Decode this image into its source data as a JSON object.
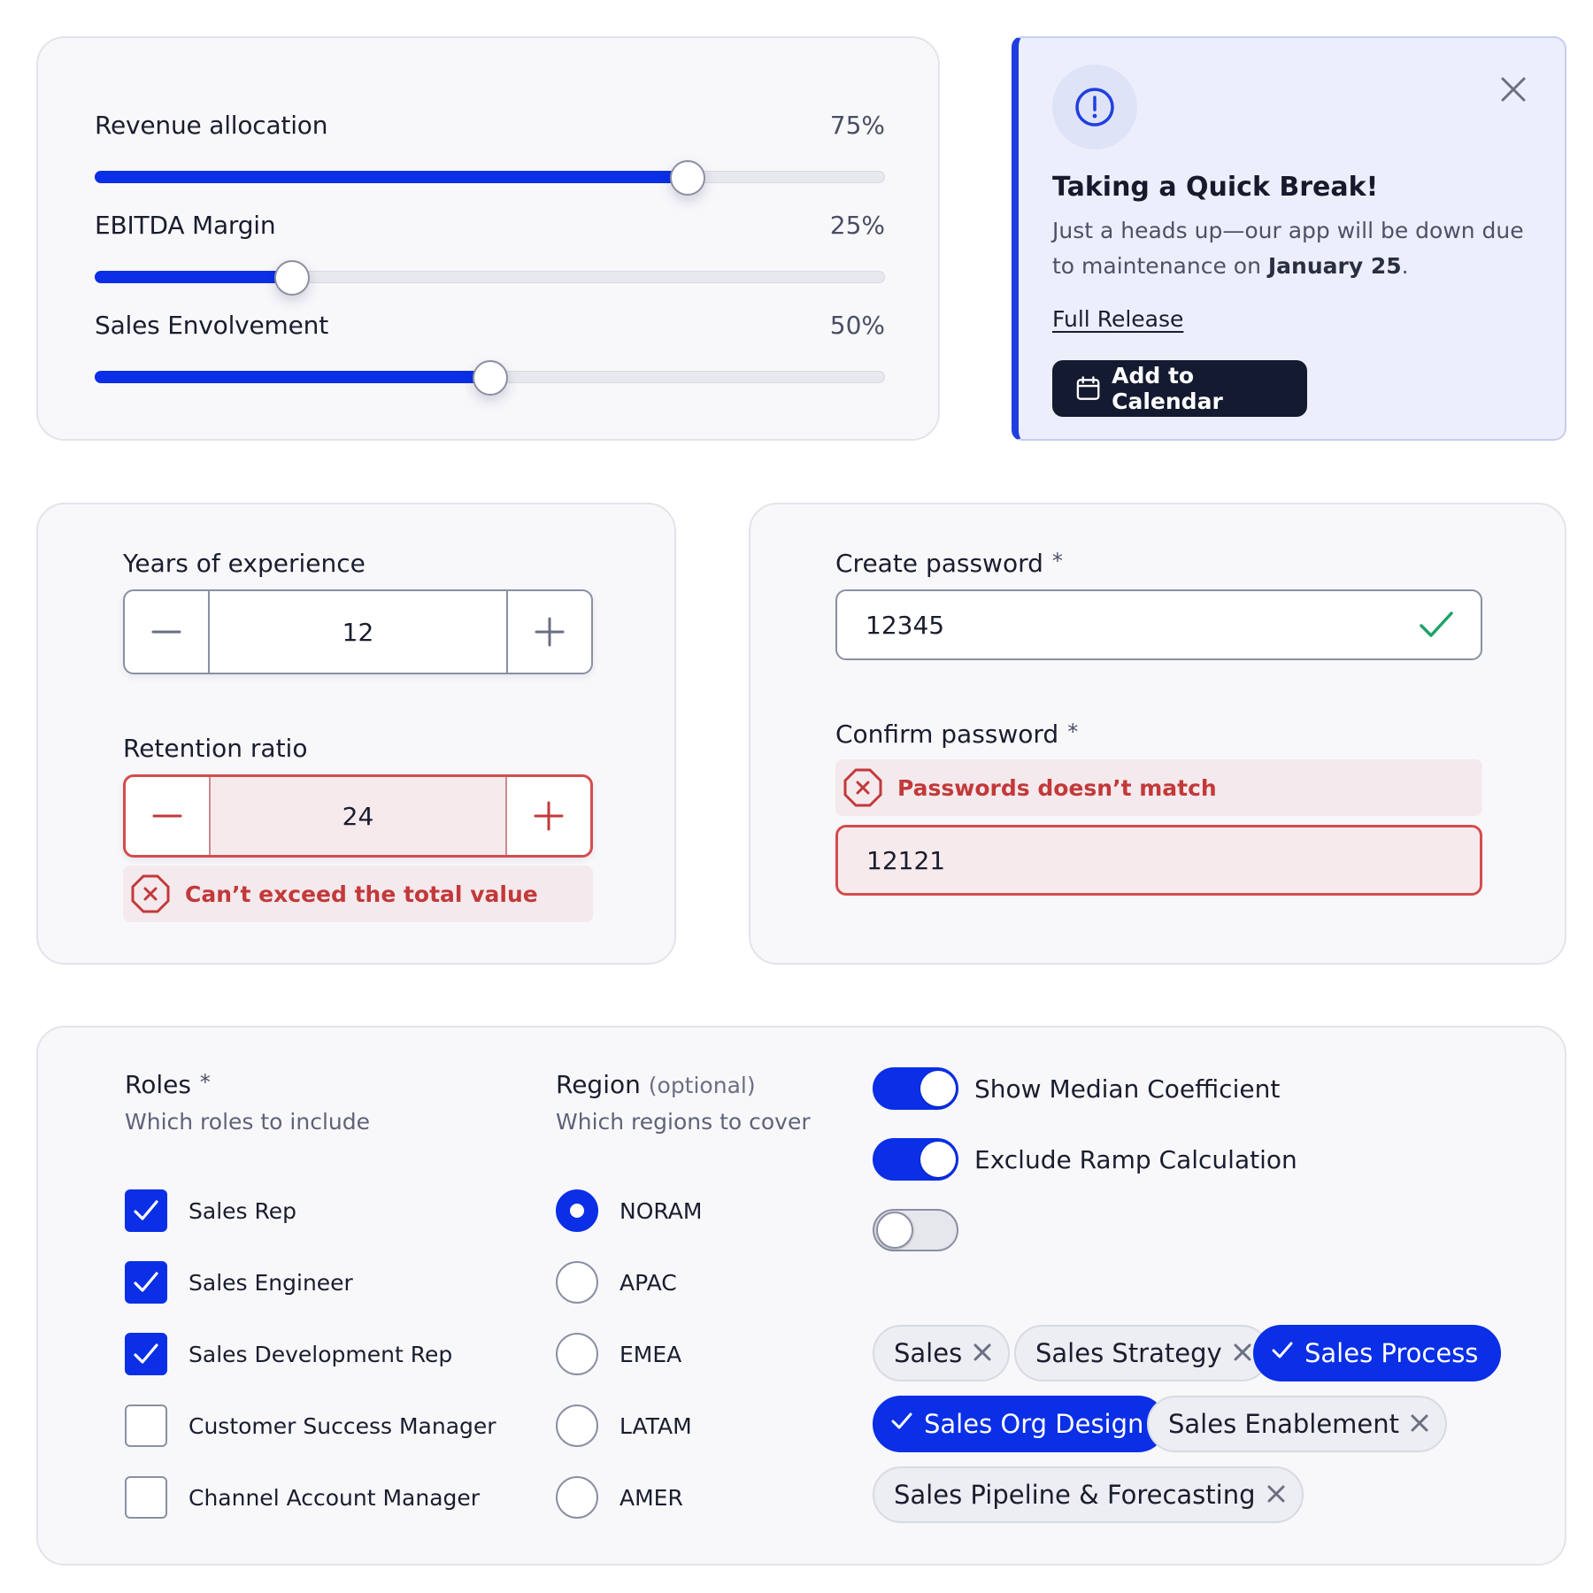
{
  "sliders": [
    {
      "label": "Revenue allocation",
      "value_text": "75%",
      "value": 0.75
    },
    {
      "label": "EBITDA Margin",
      "value_text": "25%",
      "value": 0.25
    },
    {
      "label": "Sales Envolvement",
      "value_text": "50%",
      "value": 0.5
    }
  ],
  "notice": {
    "title": "Taking a Quick Break!",
    "body_prefix": "Just a heads up—our app will be down due to maintenance on ",
    "body_date": "January 25",
    "body_suffix": ".",
    "link": "Full Release",
    "button": "Add to Calendar"
  },
  "steppers": {
    "experience": {
      "label": "Years of experience",
      "value": "12"
    },
    "retention": {
      "label": "Retention ratio",
      "value": "24",
      "error": "Can’t exceed the total value"
    }
  },
  "passwords": {
    "create": {
      "label": "Create password",
      "required": "*",
      "value": "12345"
    },
    "confirm": {
      "label": "Confirm password",
      "required": "*",
      "value": "12121",
      "error": "Passwords doesn’t match"
    }
  },
  "roles": {
    "title": "Roles",
    "required": "*",
    "subtitle": "Which roles to include",
    "items": [
      {
        "label": "Sales Rep",
        "checked": true
      },
      {
        "label": "Sales Engineer",
        "checked": true
      },
      {
        "label": "Sales Development Rep",
        "checked": true
      },
      {
        "label": "Customer Success Manager",
        "checked": false
      },
      {
        "label": "Channel Account Manager",
        "checked": false
      }
    ]
  },
  "region": {
    "title": "Region",
    "optional": "(optional)",
    "subtitle": "Which regions to cover",
    "items": [
      {
        "label": "NORAM",
        "selected": true
      },
      {
        "label": "APAC",
        "selected": false
      },
      {
        "label": "EMEA",
        "selected": false
      },
      {
        "label": "LATAM",
        "selected": false
      },
      {
        "label": "AMER",
        "selected": false
      }
    ]
  },
  "toggles": [
    {
      "label": "Show Median Coefficient",
      "on": true
    },
    {
      "label": "Exclude Ramp Calculation",
      "on": true
    },
    {
      "label": "",
      "on": false
    }
  ],
  "chips": [
    {
      "label": "Sales",
      "selected": false
    },
    {
      "label": "Sales Strategy",
      "selected": false
    },
    {
      "label": "Sales Process",
      "selected": true
    },
    {
      "label": "Sales Org Design",
      "selected": true
    },
    {
      "label": "Sales Enablement",
      "selected": false
    },
    {
      "label": "Sales Pipeline & Forecasting",
      "selected": false
    }
  ],
  "colors": {
    "accent": "#0a2fe6",
    "error": "#c2393a",
    "dark_button": "#141a30"
  }
}
